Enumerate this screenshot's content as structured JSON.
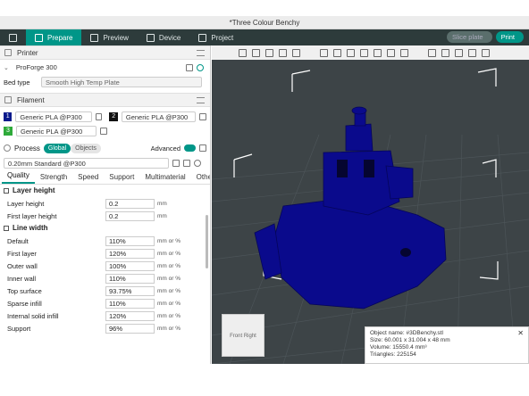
{
  "window": {
    "title": "*Three Colour Benchy"
  },
  "tabs": [
    {
      "label": "Prepare"
    },
    {
      "label": "Preview"
    },
    {
      "label": "Device"
    },
    {
      "label": "Project"
    }
  ],
  "actions": {
    "slice": "Slice plate",
    "print": "Print"
  },
  "printer": {
    "section": "Printer",
    "name": "ProForge 300",
    "bed_label": "Bed type",
    "bed_value": "Smooth High Temp Plate"
  },
  "filament": {
    "section": "Filament",
    "items": [
      {
        "num": "1",
        "color": "#0a1a8c",
        "name": "Generic PLA @P300"
      },
      {
        "num": "2",
        "color": "#111111",
        "name": "Generic PLA @P300"
      },
      {
        "num": "3",
        "color": "#2eaa3a",
        "name": "Generic PLA @P300"
      }
    ]
  },
  "process": {
    "section": "Process",
    "global": "Global",
    "objects": "Objects",
    "advanced": "Advanced",
    "profile": "0.20mm Standard @P300"
  },
  "qtabs": [
    "Quality",
    "Strength",
    "Speed",
    "Support",
    "Multimaterial",
    "Others"
  ],
  "layer_height": {
    "title": "Layer height",
    "rows": [
      {
        "label": "Layer height",
        "value": "0.2",
        "unit": "mm"
      },
      {
        "label": "First layer height",
        "value": "0.2",
        "unit": "mm"
      }
    ]
  },
  "line_width": {
    "title": "Line width",
    "rows": [
      {
        "label": "Default",
        "value": "110%",
        "unit": "mm or %"
      },
      {
        "label": "First layer",
        "value": "120%",
        "unit": "mm or %"
      },
      {
        "label": "Outer wall",
        "value": "100%",
        "unit": "mm or %"
      },
      {
        "label": "Inner wall",
        "value": "110%",
        "unit": "mm or %"
      },
      {
        "label": "Top surface",
        "value": "93.75%",
        "unit": "mm or %"
      },
      {
        "label": "Sparse infill",
        "value": "110%",
        "unit": "mm or %"
      },
      {
        "label": "Internal solid infill",
        "value": "120%",
        "unit": "mm or %"
      },
      {
        "label": "Support",
        "value": "96%",
        "unit": "mm or %"
      }
    ]
  },
  "cube": {
    "front": "Front",
    "right": "Right"
  },
  "object_info": {
    "name": "Object name: #3DBenchy.stl",
    "size": "Size: 60.001 x 31.004 x 48 mm",
    "volume": "Volume: 15550.4 mm³",
    "triangles": "Triangles: 225154"
  },
  "colors": {
    "accent": "#009688",
    "model": "#0a0a8c",
    "viewport": "#3d4447"
  }
}
